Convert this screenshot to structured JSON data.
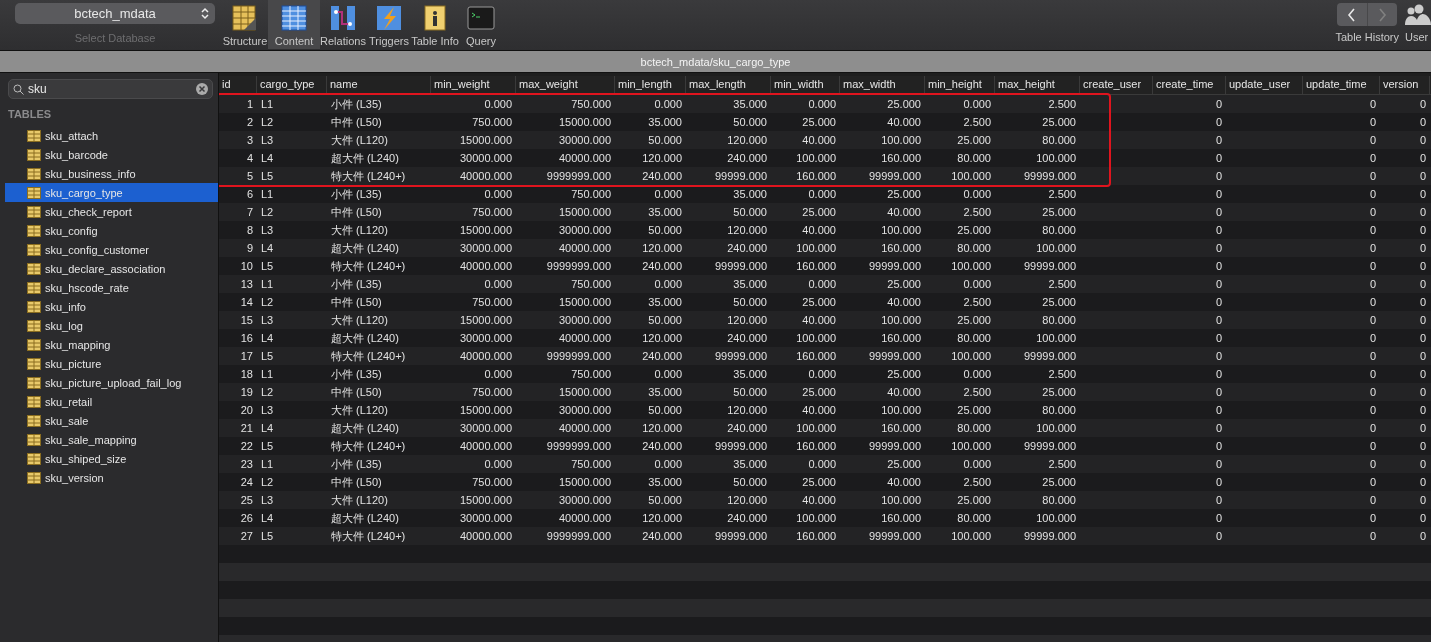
{
  "toolbar": {
    "database": {
      "value": "bctech_mdata",
      "label": "Select Database"
    },
    "tools": [
      {
        "kind": "structure",
        "label": "Structure",
        "selected": false
      },
      {
        "kind": "content",
        "label": "Content",
        "selected": true
      },
      {
        "kind": "relations",
        "label": "Relations",
        "selected": false
      },
      {
        "kind": "triggers",
        "label": "Triggers",
        "selected": false
      },
      {
        "kind": "info",
        "label": "Table Info",
        "selected": false
      },
      {
        "kind": "query",
        "label": "Query",
        "selected": false
      }
    ],
    "history": {
      "label": "Table History"
    },
    "users": {
      "label": "User"
    }
  },
  "path_bar": {
    "title": "bctech_mdata/sku_cargo_type"
  },
  "sidebar": {
    "search": {
      "value": "sku"
    },
    "section": "TABLES",
    "items": [
      {
        "label": "sku_attach",
        "selected": false
      },
      {
        "label": "sku_barcode",
        "selected": false
      },
      {
        "label": "sku_business_info",
        "selected": false
      },
      {
        "label": "sku_cargo_type",
        "selected": true
      },
      {
        "label": "sku_check_report",
        "selected": false
      },
      {
        "label": "sku_config",
        "selected": false
      },
      {
        "label": "sku_config_customer",
        "selected": false
      },
      {
        "label": "sku_declare_association",
        "selected": false
      },
      {
        "label": "sku_hscode_rate",
        "selected": false
      },
      {
        "label": "sku_info",
        "selected": false
      },
      {
        "label": "sku_log",
        "selected": false
      },
      {
        "label": "sku_mapping",
        "selected": false
      },
      {
        "label": "sku_picture",
        "selected": false
      },
      {
        "label": "sku_picture_upload_fail_log",
        "selected": false
      },
      {
        "label": "sku_retail",
        "selected": false
      },
      {
        "label": "sku_sale",
        "selected": false
      },
      {
        "label": "sku_sale_mapping",
        "selected": false
      },
      {
        "label": "sku_shiped_size",
        "selected": false
      },
      {
        "label": "sku_version",
        "selected": false
      }
    ]
  },
  "table": {
    "columns": [
      "id",
      "cargo_type",
      "name",
      "min_weight",
      "max_weight",
      "min_length",
      "max_length",
      "min_width",
      "max_width",
      "min_height",
      "max_height",
      "create_user",
      "create_time",
      "update_user",
      "update_time",
      "version"
    ],
    "rows": [
      {
        "highlighted": true,
        "cells": [
          "1",
          "L1",
          "小件 (L35)",
          "0.000",
          "750.000",
          "0.000",
          "35.000",
          "0.000",
          "25.000",
          "0.000",
          "2.500",
          null,
          "0",
          null,
          "0",
          "0"
        ]
      },
      {
        "highlighted": true,
        "cells": [
          "2",
          "L2",
          "中件 (L50)",
          "750.000",
          "15000.000",
          "35.000",
          "50.000",
          "25.000",
          "40.000",
          "2.500",
          "25.000",
          null,
          "0",
          null,
          "0",
          "0"
        ]
      },
      {
        "highlighted": true,
        "cells": [
          "3",
          "L3",
          "大件 (L120)",
          "15000.000",
          "30000.000",
          "50.000",
          "120.000",
          "40.000",
          "100.000",
          "25.000",
          "80.000",
          null,
          "0",
          null,
          "0",
          "0"
        ]
      },
      {
        "highlighted": true,
        "cells": [
          "4",
          "L4",
          "超大件 (L240)",
          "30000.000",
          "40000.000",
          "120.000",
          "240.000",
          "100.000",
          "160.000",
          "80.000",
          "100.000",
          null,
          "0",
          null,
          "0",
          "0"
        ]
      },
      {
        "highlighted": true,
        "cells": [
          "5",
          "L5",
          "特大件 (L240+)",
          "40000.000",
          "9999999.000",
          "240.000",
          "99999.000",
          "160.000",
          "99999.000",
          "100.000",
          "99999.000",
          null,
          "0",
          null,
          "0",
          "0"
        ]
      },
      {
        "highlighted": false,
        "cells": [
          "6",
          "L1",
          "小件 (L35)",
          "0.000",
          "750.000",
          "0.000",
          "35.000",
          "0.000",
          "25.000",
          "0.000",
          "2.500",
          null,
          "0",
          null,
          "0",
          "0"
        ]
      },
      {
        "highlighted": false,
        "cells": [
          "7",
          "L2",
          "中件 (L50)",
          "750.000",
          "15000.000",
          "35.000",
          "50.000",
          "25.000",
          "40.000",
          "2.500",
          "25.000",
          null,
          "0",
          null,
          "0",
          "0"
        ]
      },
      {
        "highlighted": false,
        "cells": [
          "8",
          "L3",
          "大件 (L120)",
          "15000.000",
          "30000.000",
          "50.000",
          "120.000",
          "40.000",
          "100.000",
          "25.000",
          "80.000",
          null,
          "0",
          null,
          "0",
          "0"
        ]
      },
      {
        "highlighted": false,
        "cells": [
          "9",
          "L4",
          "超大件 (L240)",
          "30000.000",
          "40000.000",
          "120.000",
          "240.000",
          "100.000",
          "160.000",
          "80.000",
          "100.000",
          null,
          "0",
          null,
          "0",
          "0"
        ]
      },
      {
        "highlighted": false,
        "cells": [
          "10",
          "L5",
          "特大件 (L240+)",
          "40000.000",
          "9999999.000",
          "240.000",
          "99999.000",
          "160.000",
          "99999.000",
          "100.000",
          "99999.000",
          null,
          "0",
          null,
          "0",
          "0"
        ]
      },
      {
        "highlighted": false,
        "cells": [
          "13",
          "L1",
          "小件 (L35)",
          "0.000",
          "750.000",
          "0.000",
          "35.000",
          "0.000",
          "25.000",
          "0.000",
          "2.500",
          null,
          "0",
          null,
          "0",
          "0"
        ]
      },
      {
        "highlighted": false,
        "cells": [
          "14",
          "L2",
          "中件 (L50)",
          "750.000",
          "15000.000",
          "35.000",
          "50.000",
          "25.000",
          "40.000",
          "2.500",
          "25.000",
          null,
          "0",
          null,
          "0",
          "0"
        ]
      },
      {
        "highlighted": false,
        "cells": [
          "15",
          "L3",
          "大件 (L120)",
          "15000.000",
          "30000.000",
          "50.000",
          "120.000",
          "40.000",
          "100.000",
          "25.000",
          "80.000",
          null,
          "0",
          null,
          "0",
          "0"
        ]
      },
      {
        "highlighted": false,
        "cells": [
          "16",
          "L4",
          "超大件 (L240)",
          "30000.000",
          "40000.000",
          "120.000",
          "240.000",
          "100.000",
          "160.000",
          "80.000",
          "100.000",
          null,
          "0",
          null,
          "0",
          "0"
        ]
      },
      {
        "highlighted": false,
        "cells": [
          "17",
          "L5",
          "特大件 (L240+)",
          "40000.000",
          "9999999.000",
          "240.000",
          "99999.000",
          "160.000",
          "99999.000",
          "100.000",
          "99999.000",
          null,
          "0",
          null,
          "0",
          "0"
        ]
      },
      {
        "highlighted": false,
        "cells": [
          "18",
          "L1",
          "小件 (L35)",
          "0.000",
          "750.000",
          "0.000",
          "35.000",
          "0.000",
          "25.000",
          "0.000",
          "2.500",
          null,
          "0",
          null,
          "0",
          "0"
        ]
      },
      {
        "highlighted": false,
        "cells": [
          "19",
          "L2",
          "中件 (L50)",
          "750.000",
          "15000.000",
          "35.000",
          "50.000",
          "25.000",
          "40.000",
          "2.500",
          "25.000",
          null,
          "0",
          null,
          "0",
          "0"
        ]
      },
      {
        "highlighted": false,
        "cells": [
          "20",
          "L3",
          "大件 (L120)",
          "15000.000",
          "30000.000",
          "50.000",
          "120.000",
          "40.000",
          "100.000",
          "25.000",
          "80.000",
          null,
          "0",
          null,
          "0",
          "0"
        ]
      },
      {
        "highlighted": false,
        "cells": [
          "21",
          "L4",
          "超大件 (L240)",
          "30000.000",
          "40000.000",
          "120.000",
          "240.000",
          "100.000",
          "160.000",
          "80.000",
          "100.000",
          null,
          "0",
          null,
          "0",
          "0"
        ]
      },
      {
        "highlighted": false,
        "cells": [
          "22",
          "L5",
          "特大件 (L240+)",
          "40000.000",
          "9999999.000",
          "240.000",
          "99999.000",
          "160.000",
          "99999.000",
          "100.000",
          "99999.000",
          null,
          "0",
          null,
          "0",
          "0"
        ]
      },
      {
        "highlighted": false,
        "cells": [
          "23",
          "L1",
          "小件 (L35)",
          "0.000",
          "750.000",
          "0.000",
          "35.000",
          "0.000",
          "25.000",
          "0.000",
          "2.500",
          null,
          "0",
          null,
          "0",
          "0"
        ]
      },
      {
        "highlighted": false,
        "cells": [
          "24",
          "L2",
          "中件 (L50)",
          "750.000",
          "15000.000",
          "35.000",
          "50.000",
          "25.000",
          "40.000",
          "2.500",
          "25.000",
          null,
          "0",
          null,
          "0",
          "0"
        ]
      },
      {
        "highlighted": false,
        "cells": [
          "25",
          "L3",
          "大件 (L120)",
          "15000.000",
          "30000.000",
          "50.000",
          "120.000",
          "40.000",
          "100.000",
          "25.000",
          "80.000",
          null,
          "0",
          null,
          "0",
          "0"
        ]
      },
      {
        "highlighted": false,
        "cells": [
          "26",
          "L4",
          "超大件 (L240)",
          "30000.000",
          "40000.000",
          "120.000",
          "240.000",
          "100.000",
          "160.000",
          "80.000",
          "100.000",
          null,
          "0",
          null,
          "0",
          "0"
        ]
      },
      {
        "highlighted": false,
        "cells": [
          "27",
          "L5",
          "特大件 (L240+)",
          "40000.000",
          "9999999.000",
          "240.000",
          "99999.000",
          "160.000",
          "99999.000",
          "100.000",
          "99999.000",
          null,
          "0",
          null,
          "0",
          "0"
        ]
      }
    ]
  }
}
